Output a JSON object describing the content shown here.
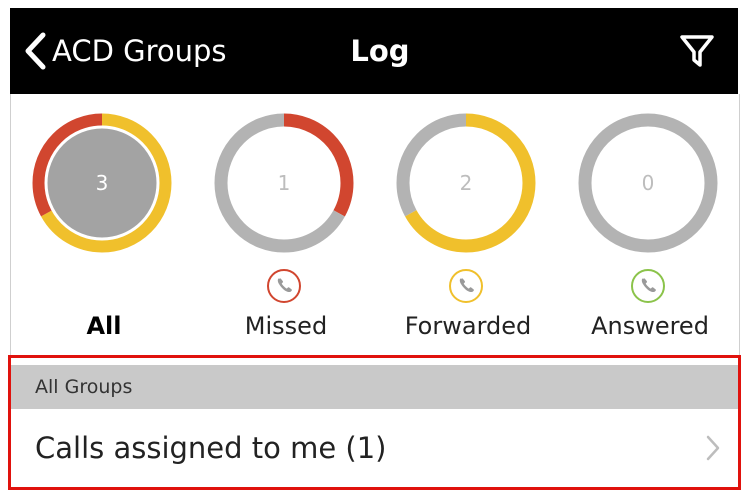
{
  "navbar": {
    "back_label": "ACD Groups",
    "title": "Log",
    "filter_icon": "filter-icon"
  },
  "stats": [
    {
      "key": "all",
      "label": "All",
      "count": "3",
      "active": true,
      "segments": [
        {
          "color": "#f0c02c",
          "fraction": 0.67
        },
        {
          "color": "#d1462f",
          "fraction": 0.33
        }
      ],
      "center_fill": "#a3a3a3",
      "count_color": "#ffffff",
      "phone_color": null
    },
    {
      "key": "missed",
      "label": "Missed",
      "count": "1",
      "active": false,
      "segments": [
        {
          "color": "#d1462f",
          "fraction": 0.33
        },
        {
          "color": "#b3b3b3",
          "fraction": 0.67
        }
      ],
      "center_fill": "#ffffff",
      "count_color": "#bdbdbd",
      "phone_color": "#d1462f"
    },
    {
      "key": "forwarded",
      "label": "Forwarded",
      "count": "2",
      "active": false,
      "segments": [
        {
          "color": "#f0c02c",
          "fraction": 0.67
        },
        {
          "color": "#b3b3b3",
          "fraction": 0.33
        }
      ],
      "center_fill": "#ffffff",
      "count_color": "#bdbdbd",
      "phone_color": "#f0c02c"
    },
    {
      "key": "answered",
      "label": "Answered",
      "count": "0",
      "active": false,
      "segments": [
        {
          "color": "#b3b3b3",
          "fraction": 1.0
        }
      ],
      "center_fill": "#ffffff",
      "count_color": "#bdbdbd",
      "phone_color": "#8bc34a"
    }
  ],
  "group_section": {
    "header": "All Groups",
    "rows": [
      {
        "label": "Calls assigned to me (1)"
      }
    ]
  },
  "colors": {
    "navbar_bg": "#000000",
    "highlight_border": "#e0120d",
    "section_header_bg": "#c9c9c9"
  }
}
